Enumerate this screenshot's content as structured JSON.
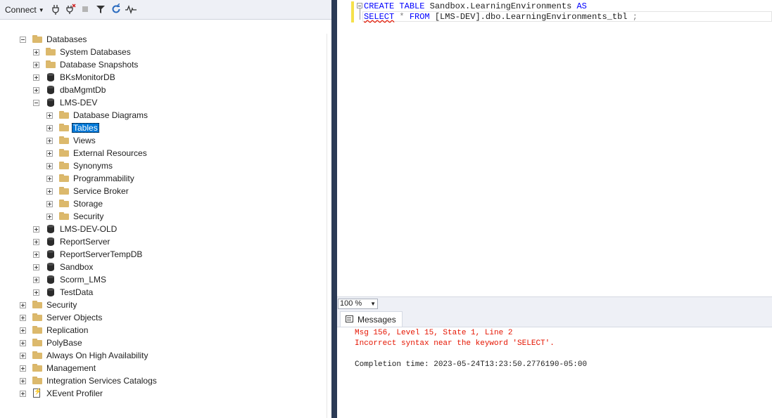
{
  "object_explorer": {
    "toolbar": {
      "connect_label": "Connect",
      "icons": [
        "connect-plug-icon",
        "disconnect-icon",
        "stop-icon",
        "filter-icon",
        "refresh-icon",
        "activity-monitor-icon"
      ]
    },
    "tree": {
      "databases_label": "Databases",
      "database_children": [
        {
          "label": "System Databases",
          "type": "folder"
        },
        {
          "label": "Database Snapshots",
          "type": "folder"
        },
        {
          "label": "BKsMonitorDB",
          "type": "database"
        },
        {
          "label": "dbaMgmtDb",
          "type": "database"
        }
      ],
      "expanded_db": {
        "label": "LMS-DEV",
        "children": [
          "Database Diagrams",
          "Tables",
          "Views",
          "External Resources",
          "Synonyms",
          "Programmability",
          "Service Broker",
          "Storage",
          "Security"
        ],
        "selected": "Tables"
      },
      "more_databases": [
        "LMS-DEV-OLD",
        "ReportServer",
        "ReportServerTempDB",
        "Sandbox",
        "Scorm_LMS",
        "TestData"
      ],
      "server_nodes": [
        "Security",
        "Server Objects",
        "Replication",
        "PolyBase",
        "Always On High Availability",
        "Management",
        "Integration Services Catalogs",
        "XEvent Profiler"
      ]
    }
  },
  "editor": {
    "line1": {
      "kw1": "CREATE",
      "kw2": "TABLE",
      "rest": "Sandbox.LearningEnvironments",
      "kw3": "AS"
    },
    "line2": {
      "kw1": "SELECT",
      "star": "*",
      "kw2": "FROM",
      "rest": "[LMS-DEV].dbo.LearningEnvironments_tbl",
      "semi": ";"
    }
  },
  "zoom": {
    "value": "100 %"
  },
  "results": {
    "tab_label": "Messages",
    "messages": {
      "error_line1": "Msg 156, Level 15, State 1, Line 2",
      "error_line2": "Incorrect syntax near the keyword 'SELECT'.",
      "completion": "Completion time: 2023-05-24T13:23:50.2776190-05:00"
    }
  },
  "colors": {
    "keyword": "#0000ff",
    "error": "#e51400",
    "selection": "#0078d7",
    "splitter": "#2b3a55",
    "folder": "#dcb96c"
  }
}
